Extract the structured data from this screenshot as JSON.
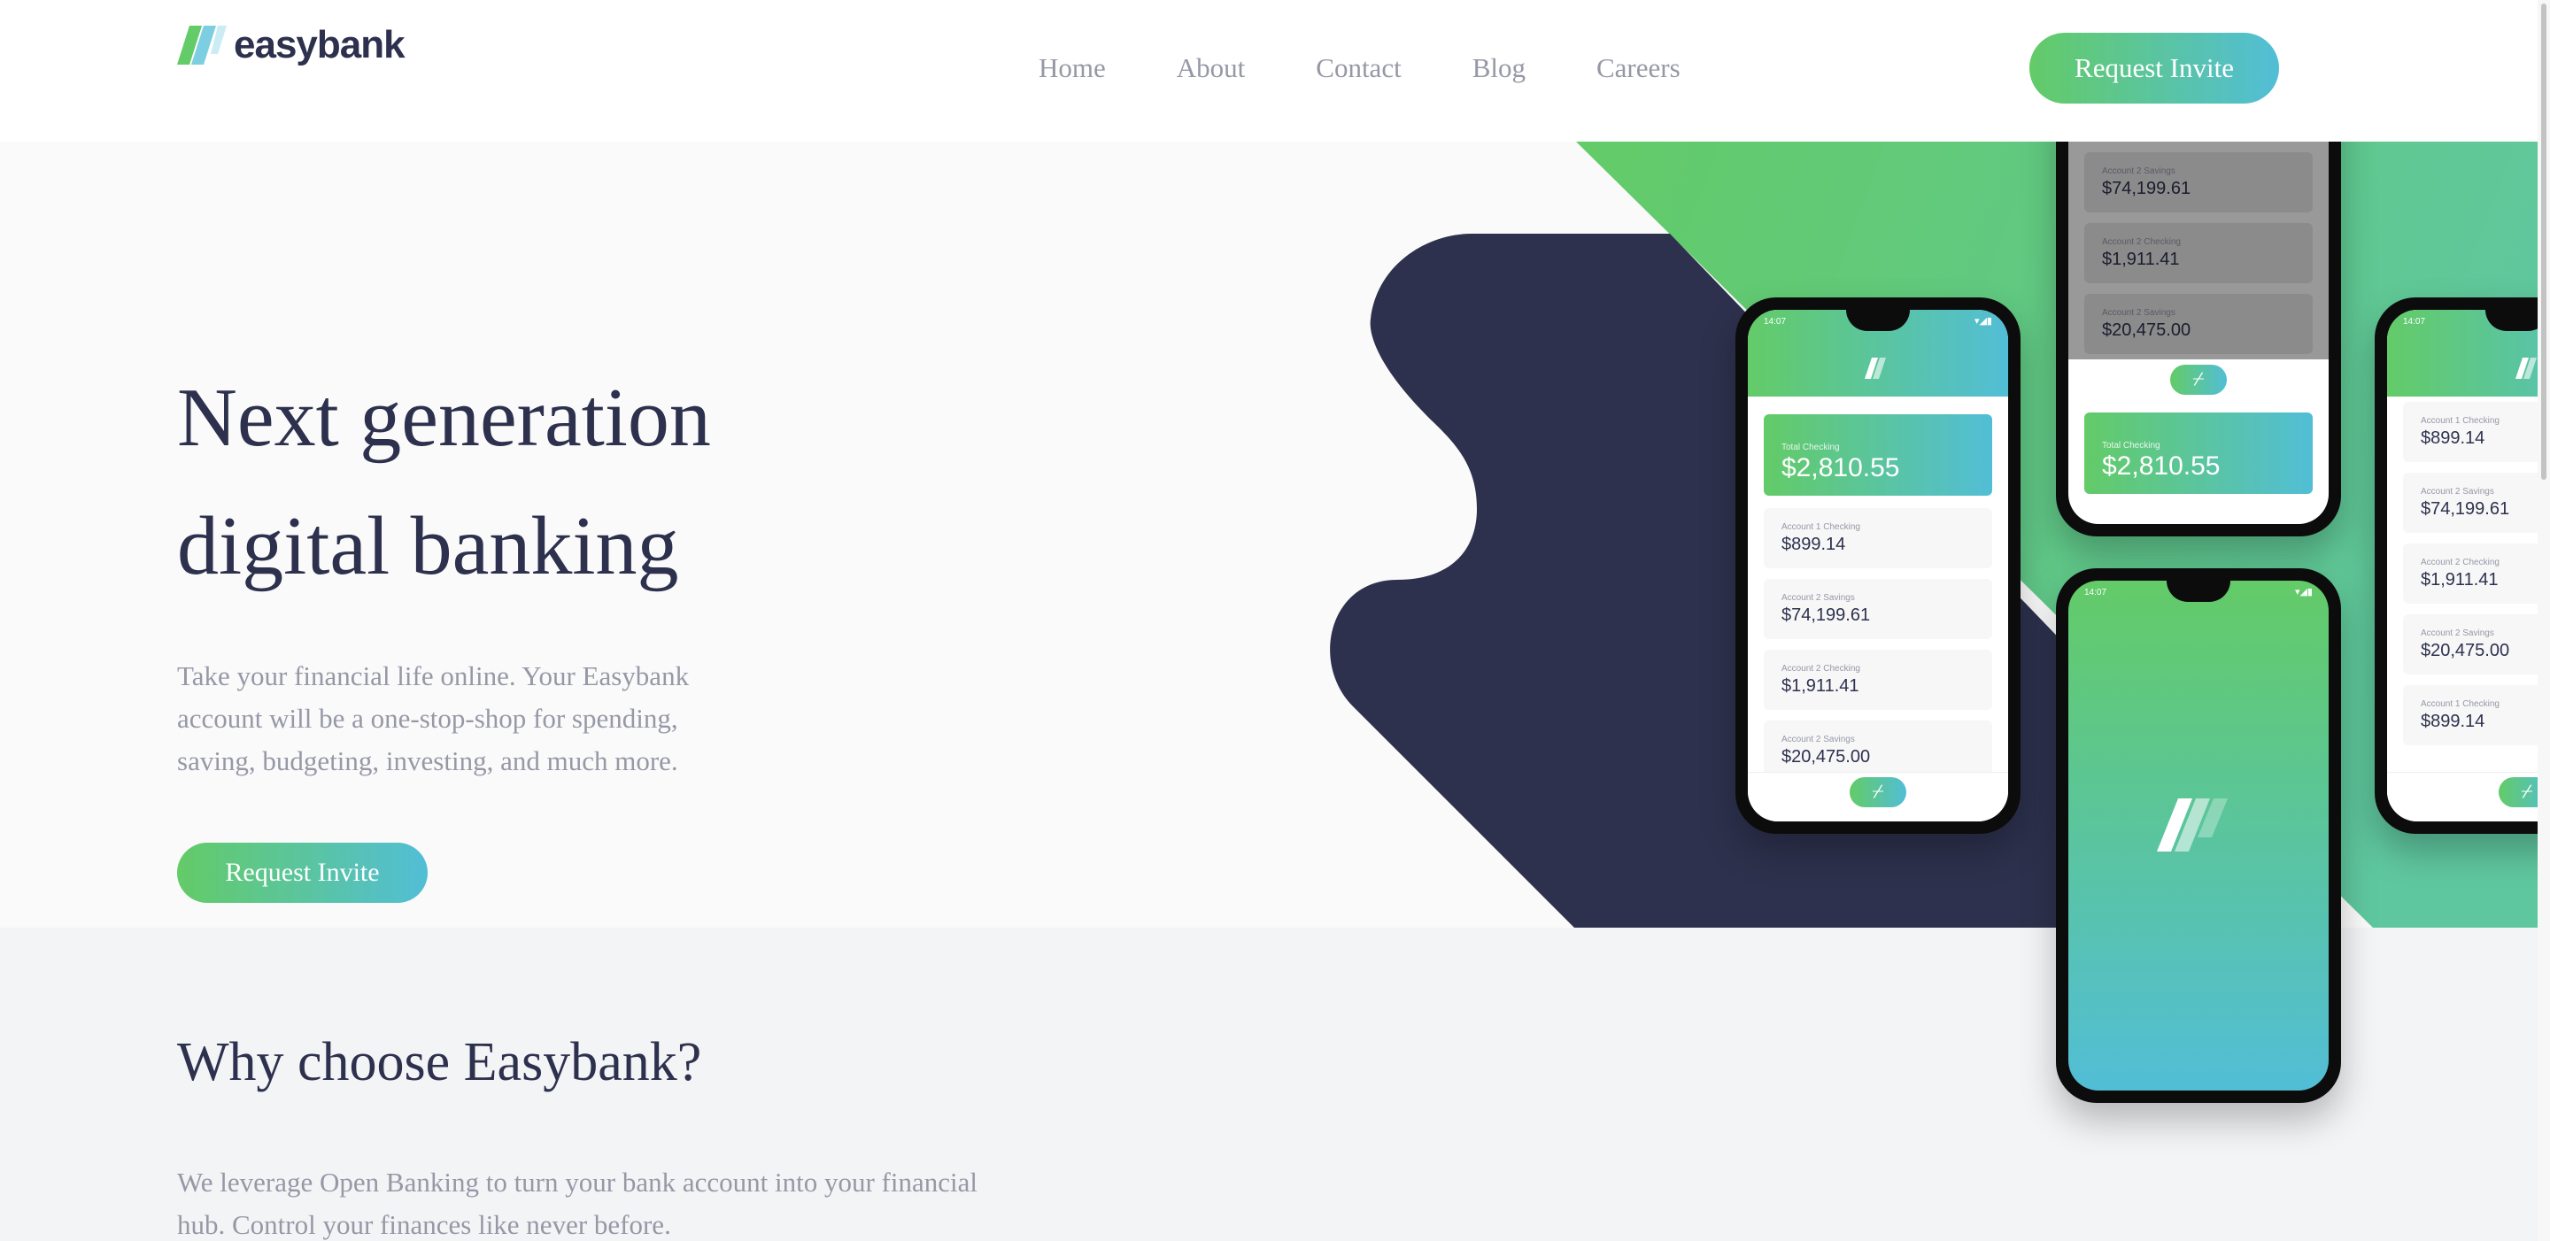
{
  "brand": {
    "name": "easybank",
    "colors": {
      "dark_blue": "#2d314d",
      "lime_green": "#63cb67",
      "bright_cyan": "#52bed6",
      "grayish_blue": "#9698a6",
      "light_gray": "#f3f4f6"
    }
  },
  "header": {
    "nav": [
      {
        "label": "Home"
      },
      {
        "label": "About"
      },
      {
        "label": "Contact"
      },
      {
        "label": "Blog"
      },
      {
        "label": "Careers"
      }
    ],
    "cta_label": "Request Invite"
  },
  "hero": {
    "title_line1": "Next generation",
    "title_line2": "digital banking",
    "text": "Take your financial life online. Your Easybank account will be a one-stop-shop for spending, saving, budgeting, investing, and much more.",
    "cta_label": "Request Invite"
  },
  "mockup": {
    "time": "14:07",
    "status_icons": "▾◢▮",
    "total_label": "Total Checking",
    "total_amount": "$2,810.55",
    "fab_icon": "plus-slash-icon",
    "accounts": [
      {
        "label": "Account 1 Checking",
        "amount": "$899.14"
      },
      {
        "label": "Account 2 Savings",
        "amount": "$74,199.61"
      },
      {
        "label": "Account 2 Checking",
        "amount": "$1,911.41"
      },
      {
        "label": "Account 2 Savings",
        "amount": "$20,475.00"
      },
      {
        "label": "Account 1 Checking",
        "amount": "$899.14"
      }
    ]
  },
  "why": {
    "title": "Why choose Easybank?",
    "text": "We leverage Open Banking to turn your bank account into your financial hub. Control your finances like never before."
  }
}
